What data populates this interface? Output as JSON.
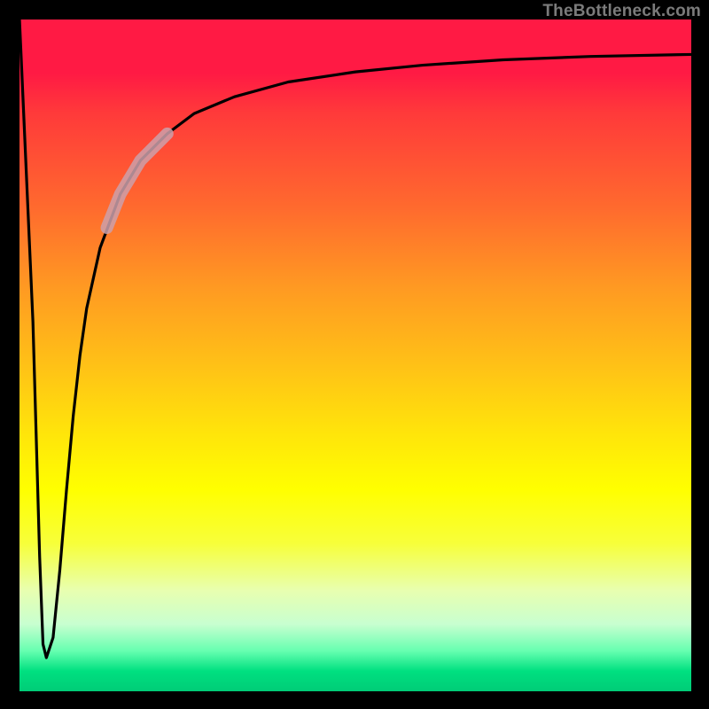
{
  "watermark": "TheBottleneck.com",
  "chart_data": {
    "type": "line",
    "title": "",
    "xlabel": "",
    "ylabel": "",
    "xlim": [
      0,
      100
    ],
    "ylim": [
      0,
      100
    ],
    "grid": false,
    "legend": false,
    "series": [
      {
        "name": "curve",
        "color": "#000000",
        "x": [
          0,
          2,
          3,
          3.5,
          4,
          5,
          6,
          7,
          8,
          9,
          10,
          12,
          15,
          18,
          22,
          26,
          32,
          40,
          50,
          60,
          72,
          85,
          100
        ],
        "values": [
          100,
          55,
          20,
          7,
          5,
          8,
          18,
          30,
          41,
          50,
          57,
          66,
          74,
          79,
          83,
          86,
          88.5,
          90.7,
          92.2,
          93.2,
          94,
          94.5,
          94.8
        ]
      },
      {
        "name": "highlight",
        "color": "rgba(210,170,180,0.85)",
        "thick": true,
        "x": [
          13,
          15,
          18,
          22
        ],
        "values": [
          69,
          74,
          79,
          83
        ]
      }
    ]
  }
}
